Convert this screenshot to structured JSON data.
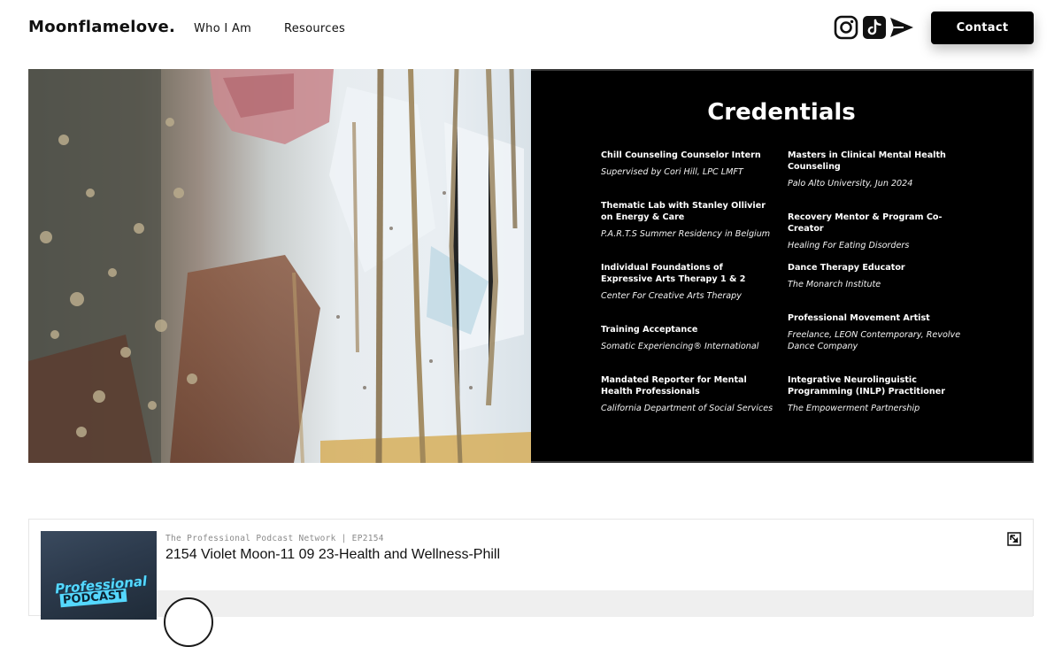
{
  "header": {
    "logo": "Moonflamelove.",
    "nav": [
      "Who I Am",
      "Resources"
    ],
    "social_icons": [
      "instagram-icon",
      "tiktok-icon",
      "send-icon"
    ],
    "contact_label": "Contact"
  },
  "credentials": {
    "title": "Credentials",
    "left_column": [
      {
        "title": "Chill Counseling Counselor Intern",
        "subtitle": "Supervised by Cori Hill, LPC LMFT"
      },
      {
        "title": "Thematic Lab with Stanley Ollivier on Energy & Care",
        "subtitle": "P.A.R.T.S Summer Residency in Belgium"
      },
      {
        "title": "Individual Foundations of Expressive Arts Therapy 1 & 2",
        "subtitle": "Center For Creative Arts Therapy"
      },
      {
        "title": "Training Acceptance",
        "subtitle": "Somatic Experiencing® International"
      },
      {
        "title": "Mandated Reporter for Mental Health Professionals",
        "subtitle": "California Department of Social Services"
      }
    ],
    "right_column": [
      {
        "title": "Masters in Clinical Mental Health Counseling",
        "subtitle": "Palo Alto University, Jun 2024"
      },
      {
        "title": "Recovery Mentor & Program Co-Creator",
        "subtitle": "Healing For Eating Disorders"
      },
      {
        "title": "Dance Therapy Educator",
        "subtitle": "The Monarch Institute"
      },
      {
        "title": "Professional Movement Artist",
        "subtitle": "Freelance, LEON Contemporary, Revolve Dance Company"
      },
      {
        "title": "Integrative Neurolinguistic Programming (INLP) Practitioner",
        "subtitle": "The Empowerment Partnership"
      }
    ]
  },
  "podcast": {
    "network": "The Professional Podcast Network | EP2154",
    "episode_title": "2154 Violet Moon-11 09 23-Health and Wellness-Phill",
    "cover_line1": "Professional",
    "cover_line2": "PODCAST"
  },
  "colors": {
    "accent": "#000000",
    "panel_bg": "#000000",
    "podcast_cover": "#55d8ff"
  }
}
